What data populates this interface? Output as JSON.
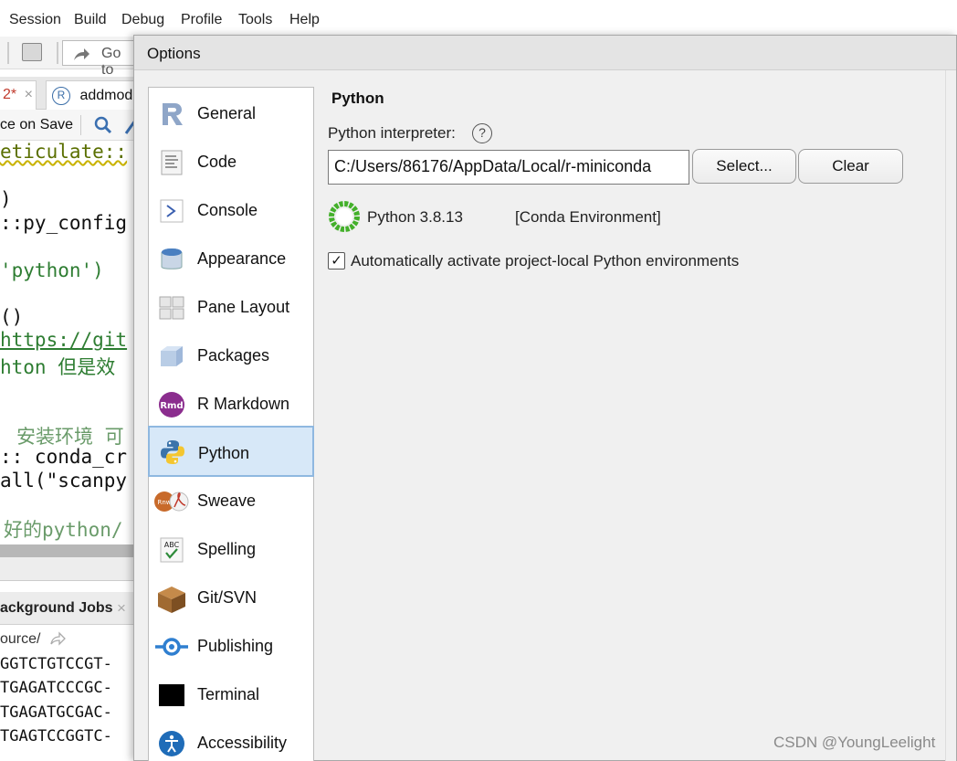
{
  "menubar": {
    "items": [
      "Session",
      "Build",
      "Debug",
      "Profile",
      "Tools",
      "Help"
    ]
  },
  "toolbar": {
    "goto_label": "Go to"
  },
  "editor_tabs": [
    {
      "label": "2*",
      "color": "#c0392b"
    },
    {
      "label": "addmod"
    }
  ],
  "editor_bar": {
    "source_on_save": "ce on Save"
  },
  "editor": {
    "lines": [
      "eticulate::",
      ")",
      "::py_config",
      "'python')",
      "()",
      "https://git",
      "hton 但是效",
      "安装环境 可",
      ":: conda_cr",
      "all(\"scanpy",
      "好的python/"
    ]
  },
  "jobs_panel": {
    "tab_label": "ackground Jobs",
    "path": "ource/",
    "console_lines": [
      "GGTCTGTCCGT-",
      "TGAGATCCCGC-",
      "TGAGATGCGAC-",
      "TGAGTCCGGTC-"
    ]
  },
  "dialog": {
    "title": "Options",
    "nav": [
      {
        "label": "General",
        "icon": "r-logo-icon"
      },
      {
        "label": "Code",
        "icon": "code-document-icon"
      },
      {
        "label": "Console",
        "icon": "console-prompt-icon"
      },
      {
        "label": "Appearance",
        "icon": "paint-bucket-icon"
      },
      {
        "label": "Pane Layout",
        "icon": "pane-grid-icon"
      },
      {
        "label": "Packages",
        "icon": "package-box-icon"
      },
      {
        "label": "R Markdown",
        "icon": "rmarkdown-icon"
      },
      {
        "label": "Python",
        "icon": "python-logo-icon",
        "selected": true
      },
      {
        "label": "Sweave",
        "icon": "sweave-pdf-icon"
      },
      {
        "label": "Spelling",
        "icon": "spelling-check-icon"
      },
      {
        "label": "Git/SVN",
        "icon": "git-box-icon"
      },
      {
        "label": "Publishing",
        "icon": "publishing-icon"
      },
      {
        "label": "Terminal",
        "icon": "terminal-icon"
      },
      {
        "label": "Accessibility",
        "icon": "accessibility-icon"
      }
    ],
    "python": {
      "title": "Python",
      "interpreter_label": "Python interpreter:",
      "help": "?",
      "interpreter_path": "C:/Users/86176/AppData/Local/r-miniconda",
      "select_button": "Select...",
      "clear_button": "Clear",
      "env_version": "Python 3.8.13",
      "env_type": "[Conda Environment]",
      "auto_activate_label": "Automatically activate project-local Python environments",
      "auto_activate_checked": true
    }
  },
  "watermark": "CSDN @YoungLeelight"
}
